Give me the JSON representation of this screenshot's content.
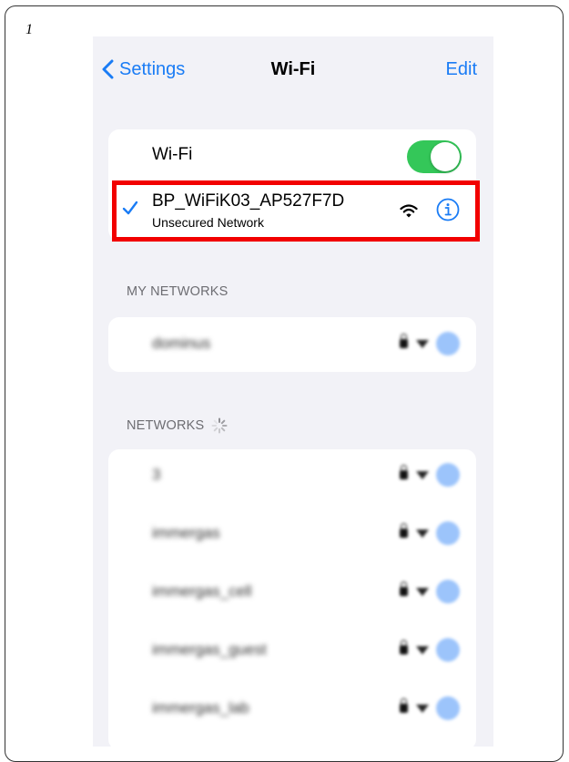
{
  "step_number": "1",
  "nav": {
    "back_label": "Settings",
    "title": "Wi-Fi",
    "edit_label": "Edit"
  },
  "wifi": {
    "label": "Wi-Fi",
    "enabled": true
  },
  "connected_network": {
    "name": "BP_WiFiK03_AP527F7D",
    "status": "Unsecured Network"
  },
  "my_networks": {
    "header": "MY NETWORKS",
    "items": [
      {
        "name": "dominus"
      }
    ]
  },
  "networks": {
    "header": "NETWORKS",
    "items": [
      {
        "name": "3"
      },
      {
        "name": "immergas"
      },
      {
        "name": "immergas_cell"
      },
      {
        "name": "immergas_guest"
      },
      {
        "name": "immergas_lab"
      }
    ]
  },
  "colors": {
    "accent": "#1a7cf5",
    "toggle_on": "#34c759",
    "highlight": "#f20000",
    "background": "#f2f2f7"
  },
  "icons": {
    "back": "chevron-left-icon",
    "check": "checkmark-icon",
    "signal": "wifi-signal-icon",
    "info": "info-icon",
    "lock": "lock-icon",
    "spinner": "loading-spinner-icon"
  }
}
